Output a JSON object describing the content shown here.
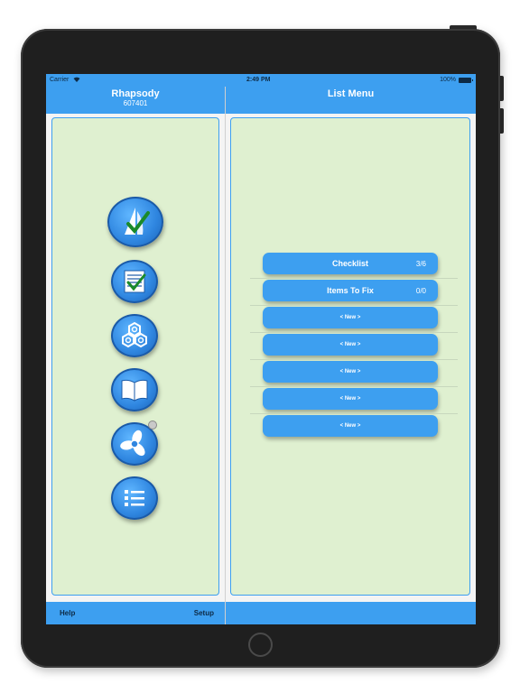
{
  "status_bar": {
    "carrier": "Carrier",
    "time": "2:49 PM",
    "battery": "100%"
  },
  "left_header": {
    "title": "Rhapsody",
    "subtitle": "607401"
  },
  "right_header": {
    "title": "List Menu"
  },
  "side_icons": [
    {
      "icon": "sailboat-check-icon"
    },
    {
      "icon": "checklist-icon"
    },
    {
      "icon": "hex-nuts-icon"
    },
    {
      "icon": "open-book-icon"
    },
    {
      "icon": "propeller-icon"
    },
    {
      "icon": "list-icon"
    }
  ],
  "lists": [
    {
      "label": "Checklist",
      "count": "3/6"
    },
    {
      "label": "Items To Fix",
      "count": "0/0"
    },
    {
      "label": "< New >",
      "count": ""
    },
    {
      "label": "< New >",
      "count": ""
    },
    {
      "label": "< New >",
      "count": ""
    },
    {
      "label": "< New >",
      "count": ""
    },
    {
      "label": "< New >",
      "count": ""
    }
  ],
  "toolbar": {
    "help_label": "Help",
    "setup_label": "Setup"
  },
  "colors": {
    "accent": "#3d9ff0",
    "panel_bg": "#dff0d0",
    "device": "#1f1f1f"
  }
}
